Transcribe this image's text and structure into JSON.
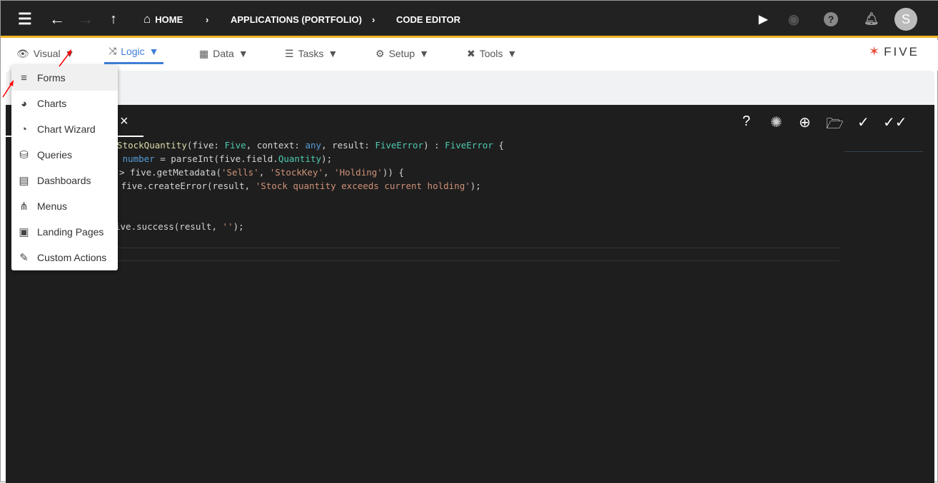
{
  "topbar": {
    "breadcrumb": [
      "HOME",
      "APPLICATIONS (PORTFOLIO)",
      "CODE EDITOR"
    ],
    "avatar": "S"
  },
  "menubar": {
    "items": [
      {
        "label": "Visual"
      },
      {
        "label": "Logic"
      },
      {
        "label": "Data"
      },
      {
        "label": "Tasks"
      },
      {
        "label": "Setup"
      },
      {
        "label": "Tools"
      }
    ],
    "caret": "▼",
    "active": "Logic",
    "accent": "#3f7fd6"
  },
  "logo": "FIVE",
  "dropdown": {
    "items": [
      "Forms",
      "Charts",
      "Chart Wizard",
      "Queries",
      "Dashboards",
      "Menus",
      "Landing Pages",
      "Custom Actions"
    ]
  },
  "editor": {
    "close": "×",
    "lines": [
      [
        [
          "fn",
          "ckStockQuantity"
        ],
        [
          "",
          "(five: "
        ],
        [
          "ty",
          "Five"
        ],
        [
          "",
          ", context: "
        ],
        [
          "kw",
          "any"
        ],
        [
          "",
          ", result: "
        ],
        [
          "ty",
          "FiveError"
        ],
        [
          "",
          ") : "
        ],
        [
          "ty",
          "FiveError"
        ],
        [
          "",
          " {"
        ]
      ],
      [
        [
          "",
          "y: "
        ],
        [
          "kw",
          "number"
        ],
        [
          "",
          " = parseInt(five.field."
        ],
        [
          "ty",
          "Quantity"
        ],
        [
          "",
          ");"
        ]
      ],
      [
        [
          "",
          "> five.getMetadata("
        ],
        [
          "st",
          "'Sells'"
        ],
        [
          "",
          ", "
        ],
        [
          "st",
          "'StockKey'"
        ],
        [
          "",
          ", "
        ],
        [
          "st",
          "'Holding'"
        ],
        [
          "",
          ")) {"
        ]
      ],
      [
        [
          "kw",
          "rn"
        ],
        [
          "",
          " five.createError(result, "
        ],
        [
          "st",
          "'Stock quantity exceeds current holding'"
        ],
        [
          "",
          ");"
        ]
      ],
      [],
      [],
      [
        [
          "",
          "ive.success(result, "
        ],
        [
          "st",
          "''"
        ],
        [
          "",
          ");"
        ]
      ]
    ]
  }
}
